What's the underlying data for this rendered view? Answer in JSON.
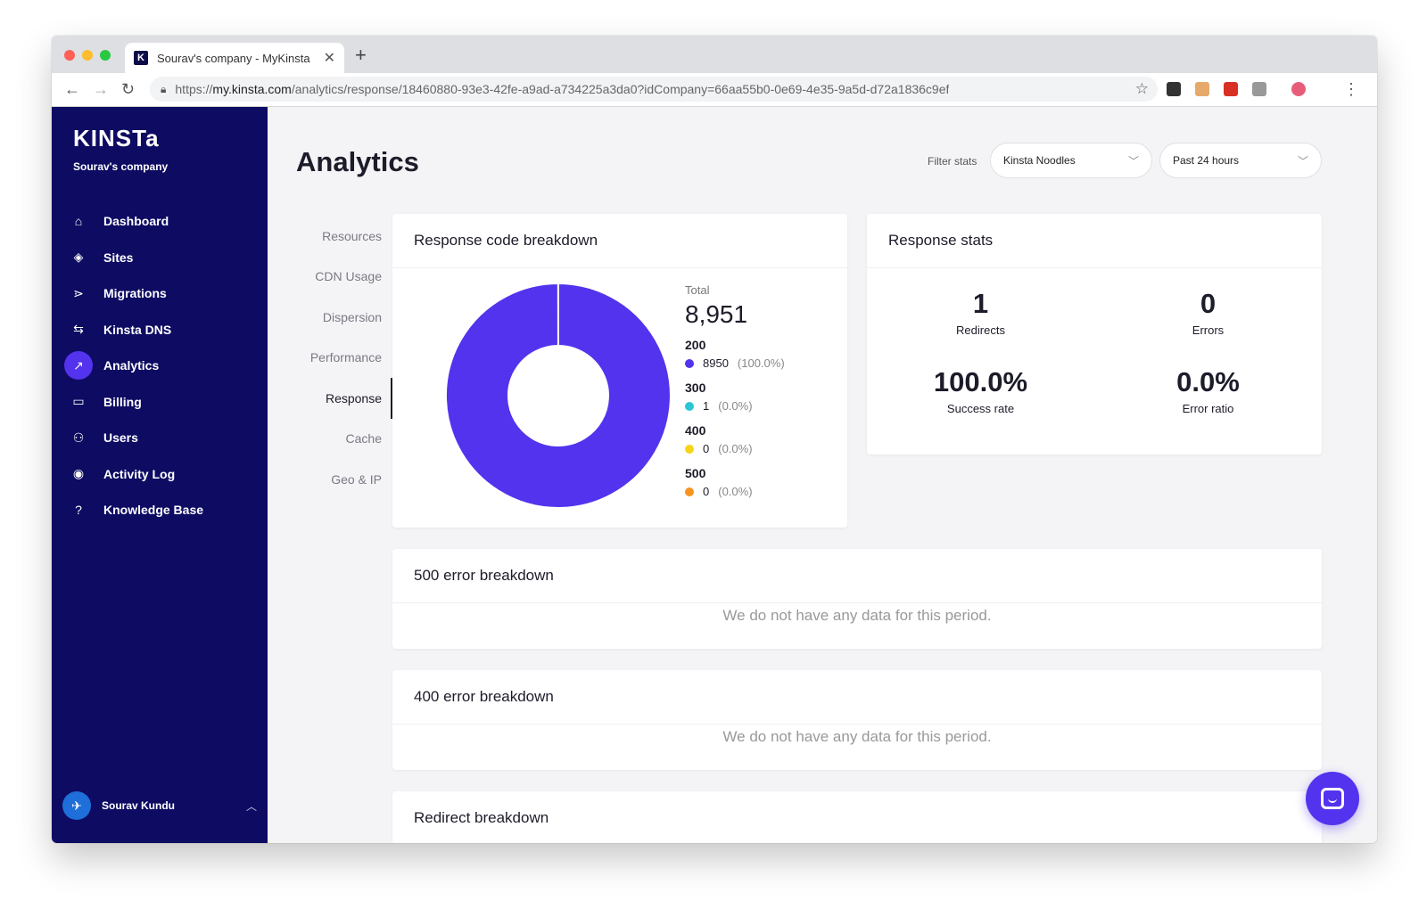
{
  "browser": {
    "tab_title": "Sourav's company - MyKinsta",
    "favicon_letter": "K",
    "url_prefix": "https://",
    "url_host": "my.kinsta.com",
    "url_path": "/analytics/response/18460880-93e3-42fe-a9ad-a734225a3da0?idCompany=66aa55b0-0e69-4e35-9a5d-d72a1836c9ef"
  },
  "sidebar": {
    "logo": "KINSTa",
    "company": "Sourav's company",
    "items": [
      {
        "label": "Dashboard",
        "icon": "home-icon",
        "glyph": "⌂"
      },
      {
        "label": "Sites",
        "icon": "layers-icon",
        "glyph": "◈"
      },
      {
        "label": "Migrations",
        "icon": "migrate-icon",
        "glyph": "⋗"
      },
      {
        "label": "Kinsta DNS",
        "icon": "dns-icon",
        "glyph": "⇆"
      },
      {
        "label": "Analytics",
        "icon": "trending-up-icon",
        "glyph": "↗"
      },
      {
        "label": "Billing",
        "icon": "card-icon",
        "glyph": "▭"
      },
      {
        "label": "Users",
        "icon": "add-user-icon",
        "glyph": "⚇"
      },
      {
        "label": "Activity Log",
        "icon": "eye-icon",
        "glyph": "◉"
      },
      {
        "label": "Knowledge Base",
        "icon": "help-icon",
        "glyph": "?"
      }
    ],
    "active_index": 4,
    "user_name": "Sourav Kundu"
  },
  "header": {
    "title": "Analytics",
    "filter_label": "Filter stats",
    "site_select": "Kinsta Noodles",
    "period_select": "Past 24 hours"
  },
  "subnav": {
    "items": [
      "Resources",
      "CDN Usage",
      "Dispersion",
      "Performance",
      "Response",
      "Cache",
      "Geo & IP"
    ],
    "active_index": 4
  },
  "response_codes": {
    "title": "Response code breakdown",
    "total_label": "Total",
    "total_value": "8,951",
    "codes": [
      {
        "code": "200",
        "count": "8950",
        "pct": "(100.0%)",
        "color": "#5333ed",
        "value": 8950
      },
      {
        "code": "300",
        "count": "1",
        "pct": "(0.0%)",
        "color": "#2bc6d6",
        "value": 1
      },
      {
        "code": "400",
        "count": "0",
        "pct": "(0.0%)",
        "color": "#f7d417",
        "value": 0
      },
      {
        "code": "500",
        "count": "0",
        "pct": "(0.0%)",
        "color": "#f7941d",
        "value": 0
      }
    ]
  },
  "response_stats": {
    "title": "Response stats",
    "redirects_value": "1",
    "redirects_label": "Redirects",
    "errors_value": "0",
    "errors_label": "Errors",
    "success_value": "100.0%",
    "success_label": "Success rate",
    "error_ratio_value": "0.0%",
    "error_ratio_label": "Error ratio"
  },
  "error500": {
    "title": "500 error breakdown",
    "empty": "We do not have any data for this period."
  },
  "error400": {
    "title": "400 error breakdown",
    "empty": "We do not have any data for this period."
  },
  "redirect": {
    "title": "Redirect breakdown"
  }
}
